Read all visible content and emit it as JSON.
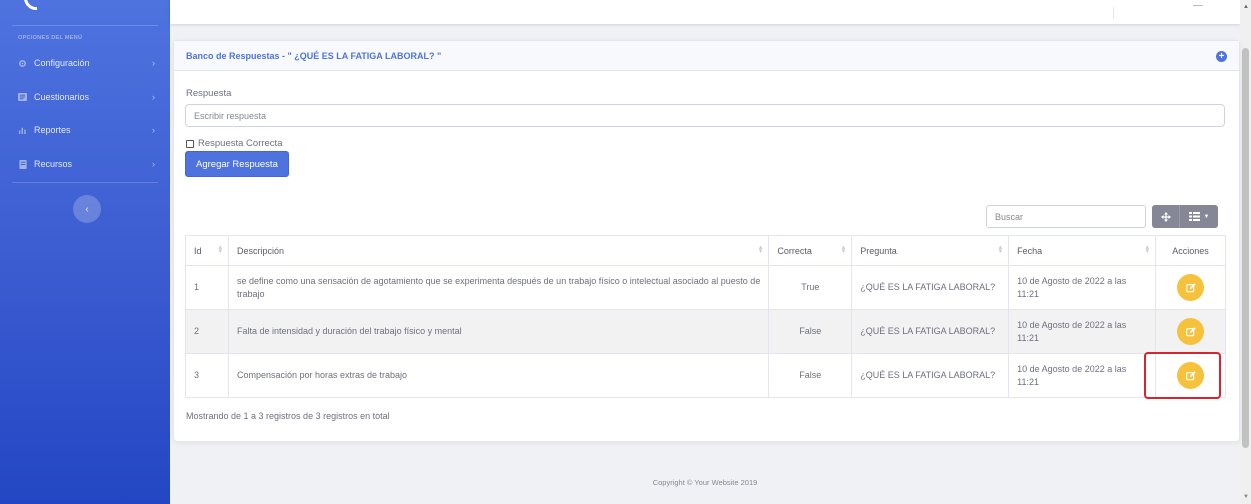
{
  "sidebar": {
    "heading": "OPCIONES DEL MENÚ",
    "items": [
      {
        "label": "Configuración",
        "icon": "gear-icon"
      },
      {
        "label": "Cuestionarios",
        "icon": "list-icon"
      },
      {
        "label": "Reportes",
        "icon": "bar-chart-icon"
      },
      {
        "label": "Recursos",
        "icon": "book-icon"
      }
    ],
    "toggle_glyph": "‹"
  },
  "card": {
    "title": "Banco de Respuestas - \" ¿QUÉ ES LA FATIGA LABORAL? \"",
    "form_label": "Respuesta",
    "input_placeholder": "Escribir respuesta",
    "checkbox_label": "Respuesta Correcta",
    "add_button": "Agregar Respuesta"
  },
  "table": {
    "search_placeholder": "Buscar",
    "columns": [
      "Id",
      "Descripción",
      "Correcta",
      "Pregunta",
      "Fecha",
      "Acciones"
    ],
    "rows": [
      {
        "id": "1",
        "descripcion": "se define como una sensación de agotamiento que se experimenta después de un trabajo físico o intelectual asociado al puesto de trabajo",
        "correcta": "True",
        "pregunta": "¿QUÉ ES LA FATIGA LABORAL?",
        "fecha": "10 de Agosto de 2022 a las 11:21"
      },
      {
        "id": "2",
        "descripcion": "Falta de intensidad y duración del trabajo físico y mental",
        "correcta": "False",
        "pregunta": "¿QUÉ ES LA FATIGA LABORAL?",
        "fecha": "10 de Agosto de 2022 a las 11:21"
      },
      {
        "id": "3",
        "descripcion": "Compensación por horas extras de trabajo",
        "correcta": "False",
        "pregunta": "¿QUÉ ES LA FATIGA LABORAL?",
        "fecha": "10 de Agosto de 2022 a las 11:21"
      }
    ],
    "footer": "Mostrando de 1 a 3 registros de 3 registros en total"
  },
  "footer": {
    "copyright": "Copyright © Your Website 2019"
  },
  "colors": {
    "primary": "#4e73df",
    "warning": "#f6c23e",
    "secondary": "#858796",
    "highlight": "#d9232d"
  }
}
